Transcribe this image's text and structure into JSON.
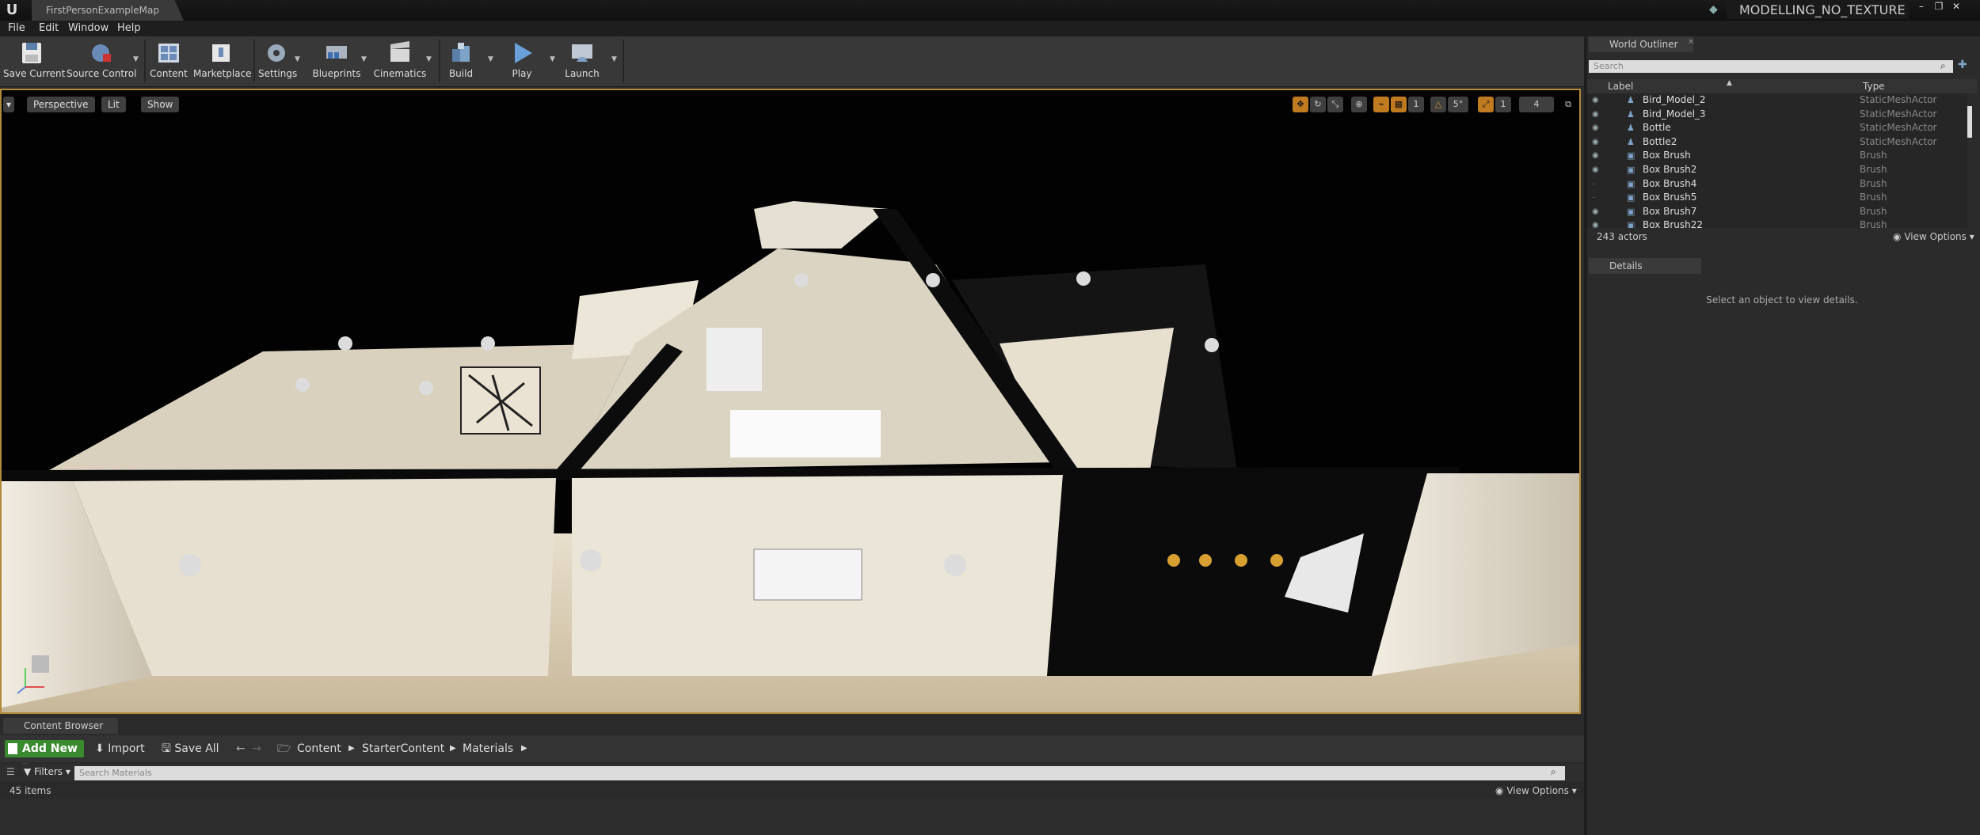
{
  "window": {
    "document_tab": "FirstPersonExampleMap",
    "project_name": "MODELLING_NO_TEXTURE"
  },
  "menu": [
    "File",
    "Edit",
    "Window",
    "Help"
  ],
  "toolbar": [
    {
      "label": "Save Current",
      "icon": "save-icon"
    },
    {
      "label": "Source Control",
      "icon": "source-control-icon"
    },
    {
      "label": "Content",
      "icon": "content-icon"
    },
    {
      "label": "Marketplace",
      "icon": "marketplace-icon"
    },
    {
      "label": "Settings",
      "icon": "settings-icon"
    },
    {
      "label": "Blueprints",
      "icon": "blueprints-icon"
    },
    {
      "label": "Cinematics",
      "icon": "cinematics-icon"
    },
    {
      "label": "Build",
      "icon": "build-icon"
    },
    {
      "label": "Play",
      "icon": "play-icon"
    },
    {
      "label": "Launch",
      "icon": "launch-icon"
    }
  ],
  "viewport": {
    "perspective": "Perspective",
    "lit": "Lit",
    "show": "Show",
    "grid_snap": "1",
    "rotation_snap": "5°",
    "scale_snap": "1",
    "camera_speed": "4"
  },
  "content_browser": {
    "tab": "Content Browser",
    "add_new": "Add New",
    "import": "Import",
    "save_all": "Save All",
    "breadcrumbs": [
      "Content",
      "StarterContent",
      "Materials"
    ],
    "filters": "Filters",
    "search_placeholder": "Search Materials",
    "item_count": "45 items",
    "view_options": "View Options"
  },
  "world_outliner": {
    "tab": "World Outliner",
    "search_placeholder": "Search",
    "col_label": "Label",
    "col_type": "Type",
    "rows": [
      {
        "name": "Bird_Model_2",
        "type": "StaticMeshActor"
      },
      {
        "name": "Bird_Model_3",
        "type": "StaticMeshActor"
      },
      {
        "name": "Bottle",
        "type": "StaticMeshActor"
      },
      {
        "name": "Bottle2",
        "type": "StaticMeshActor"
      },
      {
        "name": "Box Brush",
        "type": "Brush"
      },
      {
        "name": "Box Brush2",
        "type": "Brush"
      },
      {
        "name": "Box Brush4",
        "type": "Brush"
      },
      {
        "name": "Box Brush5",
        "type": "Brush"
      },
      {
        "name": "Box Brush7",
        "type": "Brush"
      },
      {
        "name": "Box Brush22",
        "type": "Brush"
      }
    ],
    "actor_count": "243 actors",
    "view_options": "View Options"
  },
  "details": {
    "tab": "Details",
    "empty_message": "Select an object to view details."
  },
  "colors": {
    "accent_orange": "#b08a3a",
    "add_new_green": "#3a8b2f",
    "panel_bg": "#2b2b2b"
  }
}
